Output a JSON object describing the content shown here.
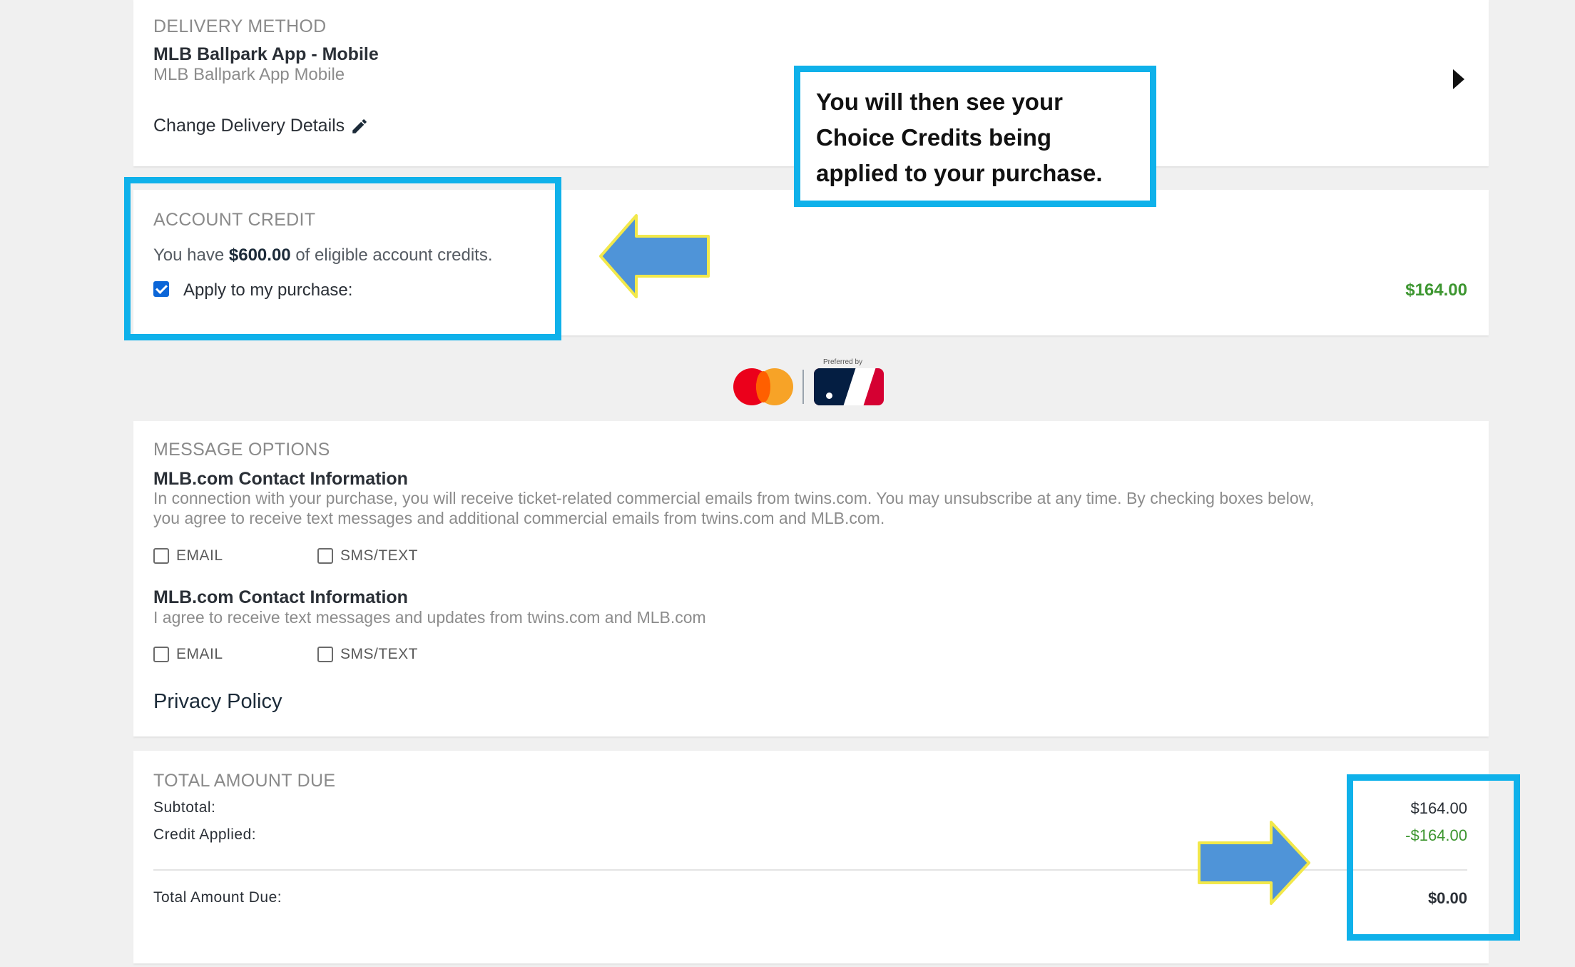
{
  "delivery": {
    "section_title": "DELIVERY METHOD",
    "method_name": "MLB Ballpark App - Mobile",
    "method_sub": "MLB Ballpark App Mobile",
    "change_link": "Change Delivery Details"
  },
  "callout": {
    "text": "You will then see your Choice Credits being applied to your purchase."
  },
  "account_credit": {
    "section_title": "ACCOUNT CREDIT",
    "you_have": "You have",
    "amount": "$600.00",
    "eligible_text": "of eligible account credits.",
    "apply_label": "Apply to my purchase:",
    "apply_checked": true,
    "applied_value": "$164.00"
  },
  "brand": {
    "badge_text": "Preferred by"
  },
  "messages": {
    "section_title": "MESSAGE OPTIONS",
    "group1": {
      "title": "MLB.com Contact Information",
      "desc_line1": "In connection with your purchase, you will receive ticket-related commercial emails from twins.com. You may unsubscribe at any time. By checking boxes below,",
      "desc_line2": "you agree to receive text messages and additional commercial emails from twins.com and MLB.com.",
      "email_label": "EMAIL",
      "sms_label": "SMS/TEXT"
    },
    "group2": {
      "title": "MLB.com Contact Information",
      "desc": "I agree to receive text messages and updates from twins.com and MLB.com",
      "email_label": "EMAIL",
      "sms_label": "SMS/TEXT"
    },
    "privacy_link": "Privacy Policy"
  },
  "totals": {
    "section_title": "TOTAL AMOUNT DUE",
    "subtotal_label": "Subtotal:",
    "subtotal_value": "$164.00",
    "credit_label": "Credit Applied:",
    "credit_value": "-$164.00",
    "total_label": "Total Amount Due:",
    "total_value": "$0.00"
  },
  "colors": {
    "highlight": "#0fb1ea",
    "arrow_fill": "#4f94d8",
    "arrow_outline": "#f2e84a",
    "credit_green": "#3d9630",
    "checkbox_blue": "#0b66d8",
    "mastercard_red": "#eb001b",
    "mastercard_orange": "#f79e1b",
    "mlb_navy": "#041e42",
    "mlb_red": "#d50032"
  }
}
